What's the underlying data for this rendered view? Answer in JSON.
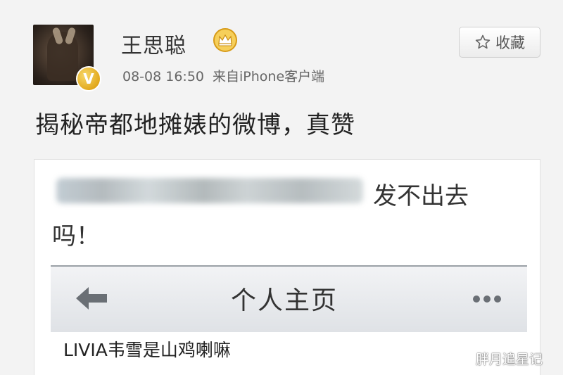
{
  "post": {
    "user": {
      "name": "王思聪",
      "verified_badge": "V",
      "crown_icon": "crown-icon"
    },
    "time": "08-08 16:50",
    "source": "来自iPhone客户端",
    "favorite_label": "收藏",
    "text": "揭秘帝都地摊婊的微博，真赞"
  },
  "embedded": {
    "line1_suffix": "发不出去",
    "line2": "吗！",
    "nav": {
      "title": "个人主页",
      "back_icon": "arrow-left-icon",
      "more_icon": "more-dots-icon"
    },
    "profile_name": "LIVIA韦雪是山鸡喇嘛"
  },
  "watermark": "胖月追星记",
  "colors": {
    "background": "#f3f3f3",
    "badge_gold": "#e2a91e",
    "text": "#222222",
    "meta": "#666666"
  }
}
